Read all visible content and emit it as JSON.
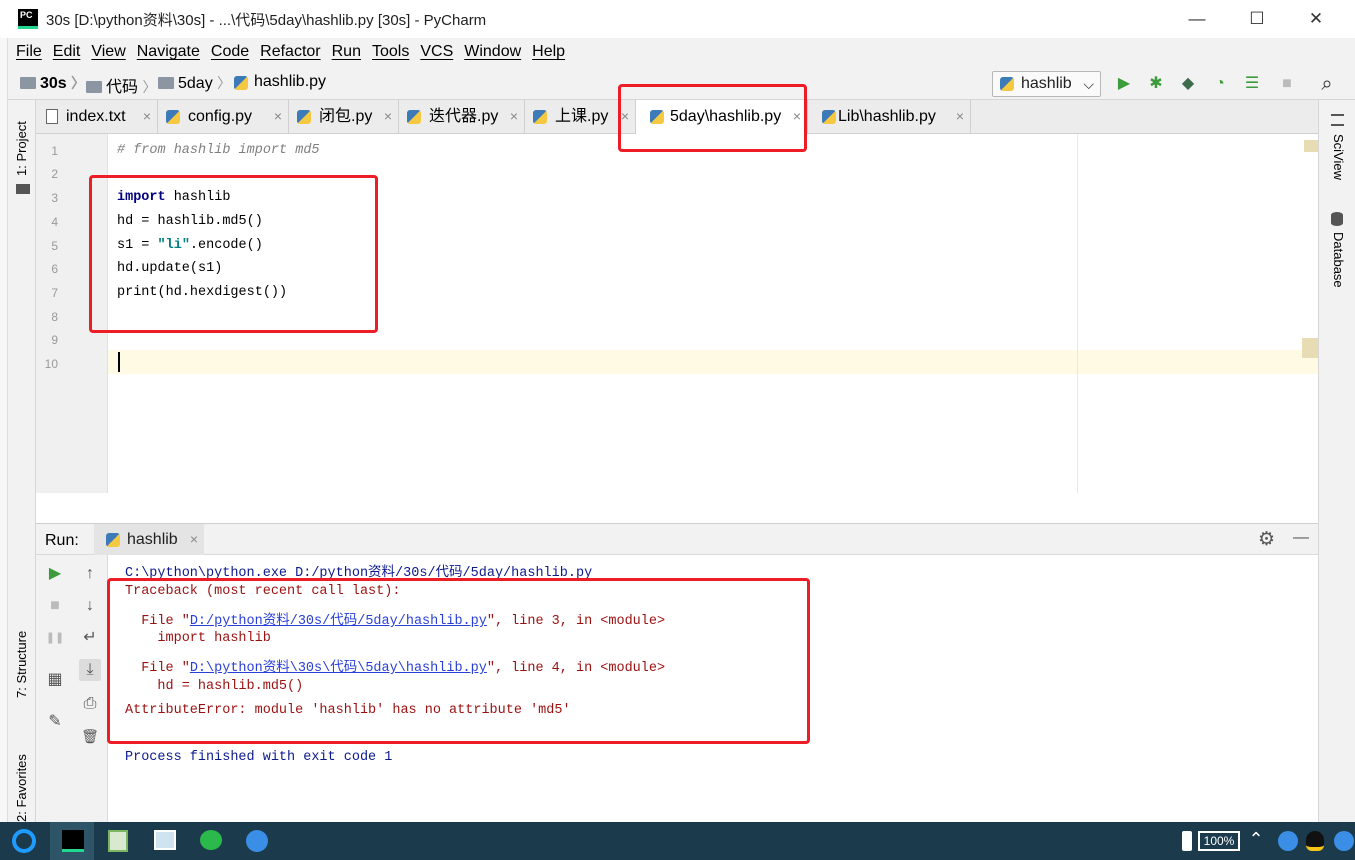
{
  "window": {
    "title": "30s [D:\\python资料\\30s] - ...\\代码\\5day\\hashlib.py [30s] - PyCharm",
    "logo_text": "PC",
    "minimize": "—",
    "maximize": "☐",
    "close": "✕"
  },
  "menu": [
    "File",
    "Edit",
    "View",
    "Navigate",
    "Code",
    "Refactor",
    "Run",
    "Tools",
    "VCS",
    "Window",
    "Help"
  ],
  "breadcrumb": [
    "30s",
    "代码",
    "5day",
    "hashlib.py"
  ],
  "run_config": {
    "label": "hashlib",
    "arrow": "⌵"
  },
  "tabs": [
    {
      "label": "index.txt"
    },
    {
      "label": "config.py"
    },
    {
      "label": "闭包.py"
    },
    {
      "label": "迭代器.py"
    },
    {
      "label": "上课.py"
    },
    {
      "label": "5day\\hashlib.py"
    },
    {
      "label": "Lib\\hashlib.py"
    }
  ],
  "tab_close": "×",
  "left_stripe": {
    "project": "1: Project",
    "structure": "7: Structure",
    "favorites": "2: Favorites"
  },
  "right_stripe": {
    "sciview": "SciView",
    "database": "Database"
  },
  "editor": {
    "line_numbers": [
      "1",
      "2",
      "3",
      "4",
      "5",
      "6",
      "7",
      "8",
      "9",
      "10"
    ],
    "comment": "# from hashlib import md5",
    "kw_import": "import",
    "import_rest": " hashlib",
    "line4": "hd = hashlib.md5()",
    "line5_a": "s1 = ",
    "line5_str": "\"li\"",
    "line5_b": ".encode()",
    "line6": "hd.update(s1)",
    "line7": "print(hd.hexdigest())"
  },
  "run_panel": {
    "label": "Run:",
    "tab": "hashlib",
    "tab_close": "×",
    "gear": "⚙",
    "minimize": "—"
  },
  "console": {
    "cmd": "C:\\python\\python.exe D:/python资料/30s/代码/5day/hashlib.py",
    "tb_header": "Traceback (most recent call last):",
    "f1_pre": "  File \"",
    "f1_link": "D:/python资料/30s/代码/5day/hashlib.py",
    "f1_post": "\", line 3, in <module>",
    "f1_src": "    import hashlib",
    "f2_pre": "  File \"",
    "f2_link": "D:\\python资料\\30s\\代码\\5day\\hashlib.py",
    "f2_post": "\", line 4, in <module>",
    "f2_src": "    hd = hashlib.md5()",
    "error": "AttributeError: module 'hashlib' has no attribute 'md5'",
    "finish": "Process finished with exit code 1"
  },
  "taskbar": {
    "battery": "100%"
  },
  "colors": {
    "annotation_red": "#ee1c25",
    "keyword": "#000080",
    "string": "#008080",
    "error_text": "#9b1111",
    "link": "#2a3fd8",
    "taskbar": "#1b3b4d",
    "run_green": "#3c9c3c"
  },
  "icons": {
    "run": "▶",
    "debug": "✱",
    "coverage": "◆",
    "profile": "◔",
    "concurrency": "☰",
    "stop": "■",
    "search": "⌕",
    "rt_rerun": "▶",
    "rt_up": "↑",
    "rt_stop": "■",
    "rt_down": "↓",
    "rt_pause": "❚❚",
    "rt_wrap": "↵",
    "rt_layout": "▦",
    "rt_scroll": "⤓",
    "rt_pin": "✎",
    "rt_print": "⎙",
    "rt_trash": "🗑"
  }
}
